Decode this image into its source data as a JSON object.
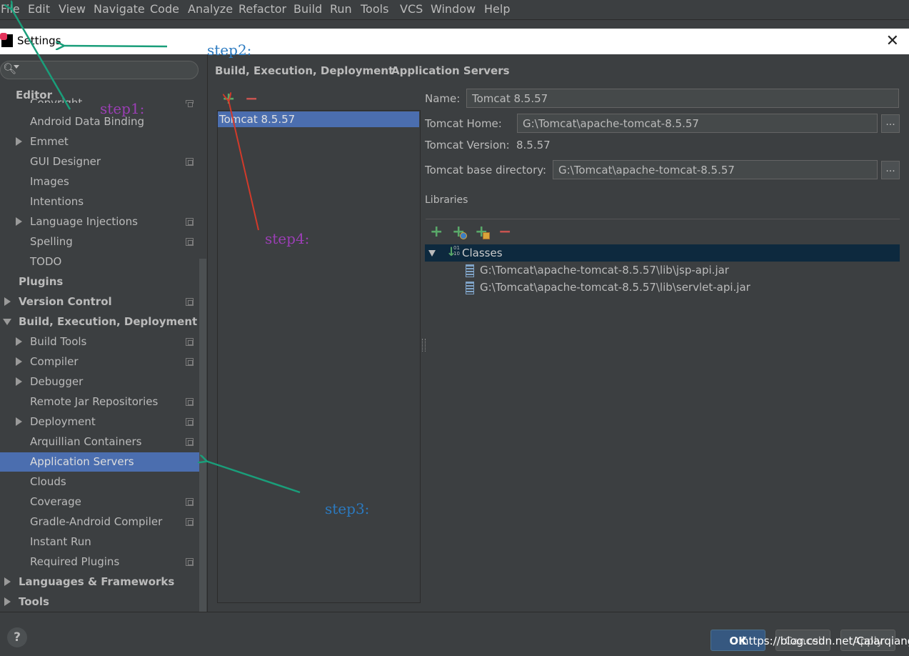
{
  "menu": [
    "File",
    "Edit",
    "View",
    "Navigate",
    "Code",
    "Analyze",
    "Refactor",
    "Build",
    "Run",
    "Tools",
    "VCS",
    "Window",
    "Help"
  ],
  "dialog": {
    "title": "Settings",
    "close_icon": "close-icon"
  },
  "search": {
    "placeholder": ""
  },
  "tree": {
    "editor": "Editor",
    "copyright": "Copyright",
    "items": [
      "Android Data Binding",
      "Emmet",
      "GUI Designer",
      "Images",
      "Intentions",
      "Language Injections",
      "Spelling",
      "TODO"
    ],
    "plugins": "Plugins",
    "version_control": "Version Control",
    "build_exec": "Build, Execution, Deployment",
    "build_items": [
      "Build Tools",
      "Compiler",
      "Debugger",
      "Remote Jar Repositories",
      "Deployment",
      "Arquillian Containers",
      "Application Servers",
      "Clouds",
      "Coverage",
      "Gradle-Android Compiler",
      "Instant Run",
      "Required Plugins"
    ],
    "languages": "Languages & Frameworks",
    "tools": "Tools"
  },
  "breadcrumb": {
    "parent": "Build, Execution, Deployment",
    "separator": "›",
    "current": "Application Servers"
  },
  "servers": {
    "items": [
      "Tomcat 8.5.57"
    ]
  },
  "form": {
    "name_label": "Name:",
    "name_value": "Tomcat 8.5.57",
    "home_label": "Tomcat Home:",
    "home_value": "G:\\Tomcat\\apache-tomcat-8.5.57",
    "version_label": "Tomcat Version:",
    "version_value": "8.5.57",
    "base_label": "Tomcat base directory:",
    "base_value": "G:\\Tomcat\\apache-tomcat-8.5.57",
    "browse": "...",
    "libraries_label": "Libraries"
  },
  "libraries": {
    "classes_label": "Classes",
    "jars": [
      "G:\\Tomcat\\apache-tomcat-8.5.57\\lib\\jsp-api.jar",
      "G:\\Tomcat\\apache-tomcat-8.5.57\\lib\\servlet-api.jar"
    ]
  },
  "buttons": {
    "ok": "OK",
    "cancel": "Cancel",
    "apply": "Apply",
    "help": "?"
  },
  "watermark": "https://blog.csdn.net/Calarqiang",
  "annotations": {
    "step1": "step1:",
    "step2": "step2:",
    "step3": "step3:",
    "step4": "step4:"
  },
  "colors": {
    "selection": "#4b6eaf",
    "background": "#3c3f41",
    "add": "#59a869",
    "remove": "#c75450",
    "arrow_green": "#1a9e7a",
    "arrow_red": "#d23a2a",
    "step_purple": "#9b3fb5",
    "step_blue": "#2b7ac0"
  }
}
